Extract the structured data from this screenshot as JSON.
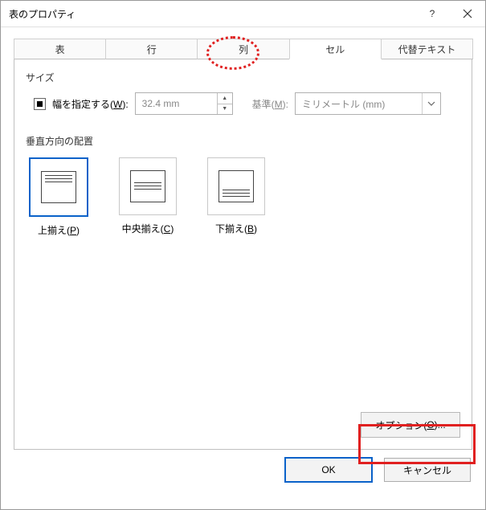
{
  "window": {
    "title": "表のプロパティ"
  },
  "tabs": {
    "items": [
      "表",
      "行",
      "列",
      "セル",
      "代替テキスト"
    ],
    "activeIndex": 3
  },
  "size": {
    "section_label": "サイズ",
    "width_checkbox_label_prefix": "幅を指定する(",
    "width_checkbox_key": "W",
    "width_checkbox_label_suffix": "):",
    "width_value": "32.4 mm",
    "unit_label_prefix": "基準(",
    "unit_key": "M",
    "unit_label_suffix": "):",
    "unit_value": "ミリメートル (mm)"
  },
  "valign": {
    "section_label": "垂直方向の配置",
    "options": [
      {
        "label_prefix": "上揃え(",
        "key": "P",
        "label_suffix": ")"
      },
      {
        "label_prefix": "中央揃え(",
        "key": "C",
        "label_suffix": ")"
      },
      {
        "label_prefix": "下揃え(",
        "key": "B",
        "label_suffix": ")"
      }
    ],
    "selectedIndex": 0
  },
  "options_button": {
    "label_prefix": "オプション(",
    "key": "O",
    "label_suffix": ")..."
  },
  "footer": {
    "ok": "OK",
    "cancel": "キャンセル"
  }
}
